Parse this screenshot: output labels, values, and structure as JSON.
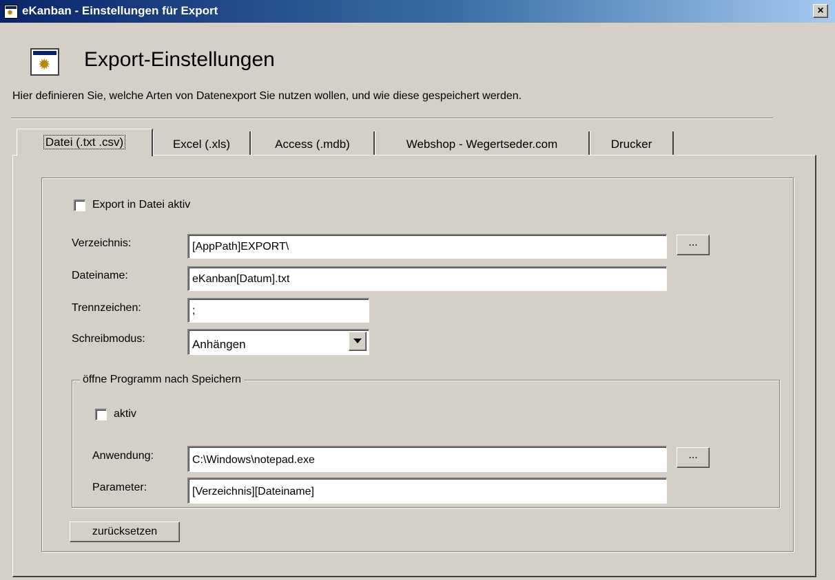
{
  "window": {
    "title": "eKanban - Einstellungen für Export",
    "close_label": "×"
  },
  "header": {
    "title": "Export-Einstellungen",
    "description": "Hier definieren Sie, welche Arten von Datenexport Sie nutzen wollen, und wie diese gespeichert werden."
  },
  "tabs": [
    {
      "label": "Datei (.txt .csv)"
    },
    {
      "label": "Excel (.xls)"
    },
    {
      "label": "Access (.mdb)"
    },
    {
      "label": "Webshop - Wegertseder.com"
    },
    {
      "label": "Drucker"
    }
  ],
  "datei": {
    "export_active_label": "Export in Datei aktiv",
    "export_active_checked": false,
    "verzeichnis_label": "Verzeichnis:",
    "verzeichnis_value": "[AppPath]EXPORT\\",
    "browse_label": "...",
    "dateiname_label": "Dateiname:",
    "dateiname_value": "eKanban[Datum].txt",
    "trennzeichen_label": "Trennzeichen:",
    "trennzeichen_value": ";",
    "schreibmodus_label": "Schreibmodus:",
    "schreibmodus_value": "Anhängen"
  },
  "open_program": {
    "legend": "öffne Programm nach Speichern",
    "active_label": "aktiv",
    "active_checked": false,
    "anwendung_label": "Anwendung:",
    "anwendung_value": "C:\\Windows\\notepad.exe",
    "browse_label": "...",
    "parameter_label": "Parameter:",
    "parameter_value": "[Verzeichnis][Dateiname]"
  },
  "reset_label": "zurücksetzen"
}
